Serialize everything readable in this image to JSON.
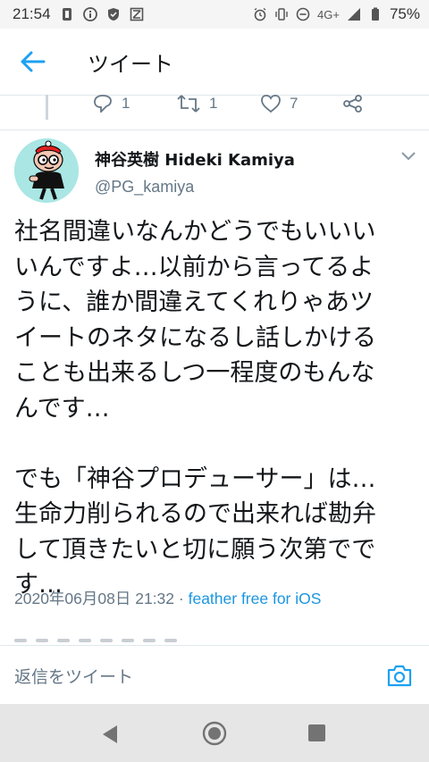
{
  "status_bar": {
    "time": "21:54",
    "network": "4G+",
    "battery": "75%"
  },
  "app_bar": {
    "title": "ツイート"
  },
  "prev_actions": {
    "reply_count": "1",
    "retweet_count": "1",
    "like_count": "7"
  },
  "tweet": {
    "display_name": "神谷英樹 Hideki Kamiya",
    "handle": "@PG_kamiya",
    "text": "社名間違いなんかどうでもいいい\nいんですよ…以前から言ってるよ\nうに、誰か間違えてくれりゃあツ\nイートのネタになるし話しかける\nことも出来るしつ一程度のもんな\nんです…\n\nでも「神谷プロデューサー」は…\n生命力削られるので出来れば勘弁\nして頂きたいと切に願う次第でで\nす…",
    "timestamp": "2020年06月08日 21:32",
    "separator": " · ",
    "client": "feather free for iOS"
  },
  "reply_bar": {
    "placeholder": "返信をツイート"
  },
  "colors": {
    "accent": "#1da1f2",
    "secondary_text": "#657786",
    "avatar_bg": "#a9e6e4"
  },
  "icons": {
    "back": "arrow-left-icon",
    "reply": "reply-icon",
    "retweet": "retweet-icon",
    "like": "heart-icon",
    "share": "share-icon",
    "caret": "chevron-down-icon",
    "camera": "camera-icon"
  }
}
